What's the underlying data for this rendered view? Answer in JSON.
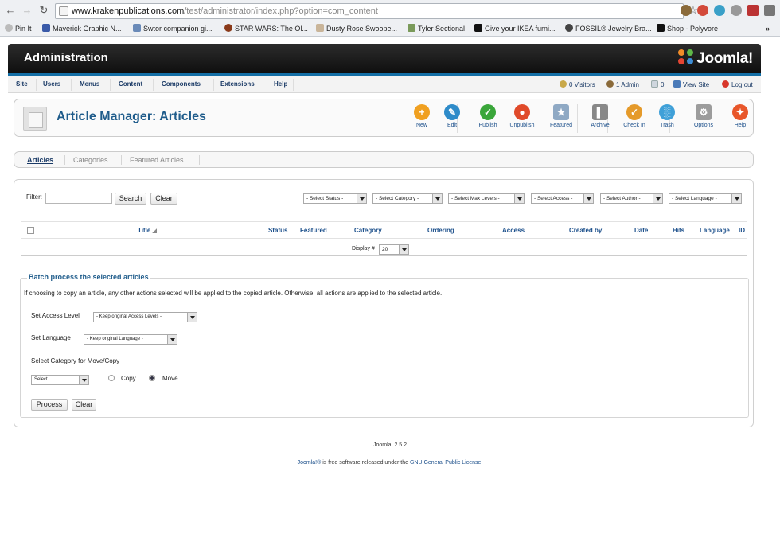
{
  "browser": {
    "url_host": "www.krakenpublications.com",
    "url_path": "/test/administrator/index.php?option=com_content",
    "bookmarks": [
      "Pin It",
      "Maverick Graphic N...",
      "Swtor companion gi...",
      "STAR WARS: The Ol...",
      "Dusty Rose Swoope...",
      "Tyler Sectional",
      "Give your IKEA furni...",
      "FOSSIL® Jewelry Bra...",
      "Shop - Polyvore"
    ]
  },
  "header": {
    "title": "Administration",
    "logo": "Joomla!"
  },
  "menu": {
    "items": [
      "Site",
      "Users",
      "Menus",
      "Content",
      "Components",
      "Extensions",
      "Help"
    ],
    "status": {
      "visitors": "0 Visitors",
      "admin": "1 Admin",
      "messages": "0",
      "view_site": "View Site",
      "logout": "Log out"
    }
  },
  "toolbar": {
    "title": "Article Manager: Articles",
    "buttons": [
      {
        "label": "New",
        "icon": "plus-icon",
        "color": "#f0a020"
      },
      {
        "label": "Edit",
        "icon": "pencil-icon",
        "color": "#2e8bc9"
      },
      {
        "label": "Publish",
        "icon": "check-icon",
        "color": "#3aa63a"
      },
      {
        "label": "Unpublish",
        "icon": "stop-icon",
        "color": "#e04a2a"
      },
      {
        "label": "Featured",
        "icon": "featured-icon",
        "color": "#8fa9c4"
      },
      {
        "label": "Archive",
        "icon": "archive-icon",
        "color": "#888888"
      },
      {
        "label": "Check In",
        "icon": "checkin-icon",
        "color": "#e59a2a"
      },
      {
        "label": "Trash",
        "icon": "trash-icon",
        "color": "#3fa0d8"
      },
      {
        "label": "Options",
        "icon": "options-icon",
        "color": "#9c9c9c"
      },
      {
        "label": "Help",
        "icon": "help-icon",
        "color": "#e8562a"
      }
    ]
  },
  "subnav": {
    "tabs": [
      "Articles",
      "Categories",
      "Featured Articles"
    ],
    "active": "Articles"
  },
  "filters": {
    "filter_label": "Filter:",
    "filter_value": "",
    "search_button": "Search",
    "clear_button": "Clear",
    "selects": [
      "- Select Status -",
      "- Select Category -",
      "- Select Max Levels -",
      "- Select Access -",
      "- Select Author -",
      "- Select Language -"
    ]
  },
  "table": {
    "columns": [
      "Title",
      "Status",
      "Featured",
      "Category",
      "Ordering",
      "Access",
      "Created by",
      "Date",
      "Hits",
      "Language",
      "ID"
    ],
    "display_label": "Display #",
    "display_value": "20"
  },
  "batch": {
    "legend": "Batch process the selected articles",
    "description": "If choosing to copy an article, any other actions selected will be applied to the copied article. Otherwise, all actions are applied to the selected article.",
    "access_label": "Set Access Level",
    "access_value": "- Keep original Access Levels -",
    "language_label": "Set Language",
    "language_value": "- Keep original Language -",
    "category_label": "Select Category for Move/Copy",
    "category_value": "Select",
    "copy_label": "Copy",
    "move_label": "Move",
    "selected_action": "Move",
    "process_button": "Process",
    "clear_button": "Clear"
  },
  "footer": {
    "version": "Joomla! 2.5.2",
    "license_link1": "Joomla!®",
    "license_text": " is free software released under the ",
    "license_link2": "GNU General Public License",
    "license_end": "."
  }
}
